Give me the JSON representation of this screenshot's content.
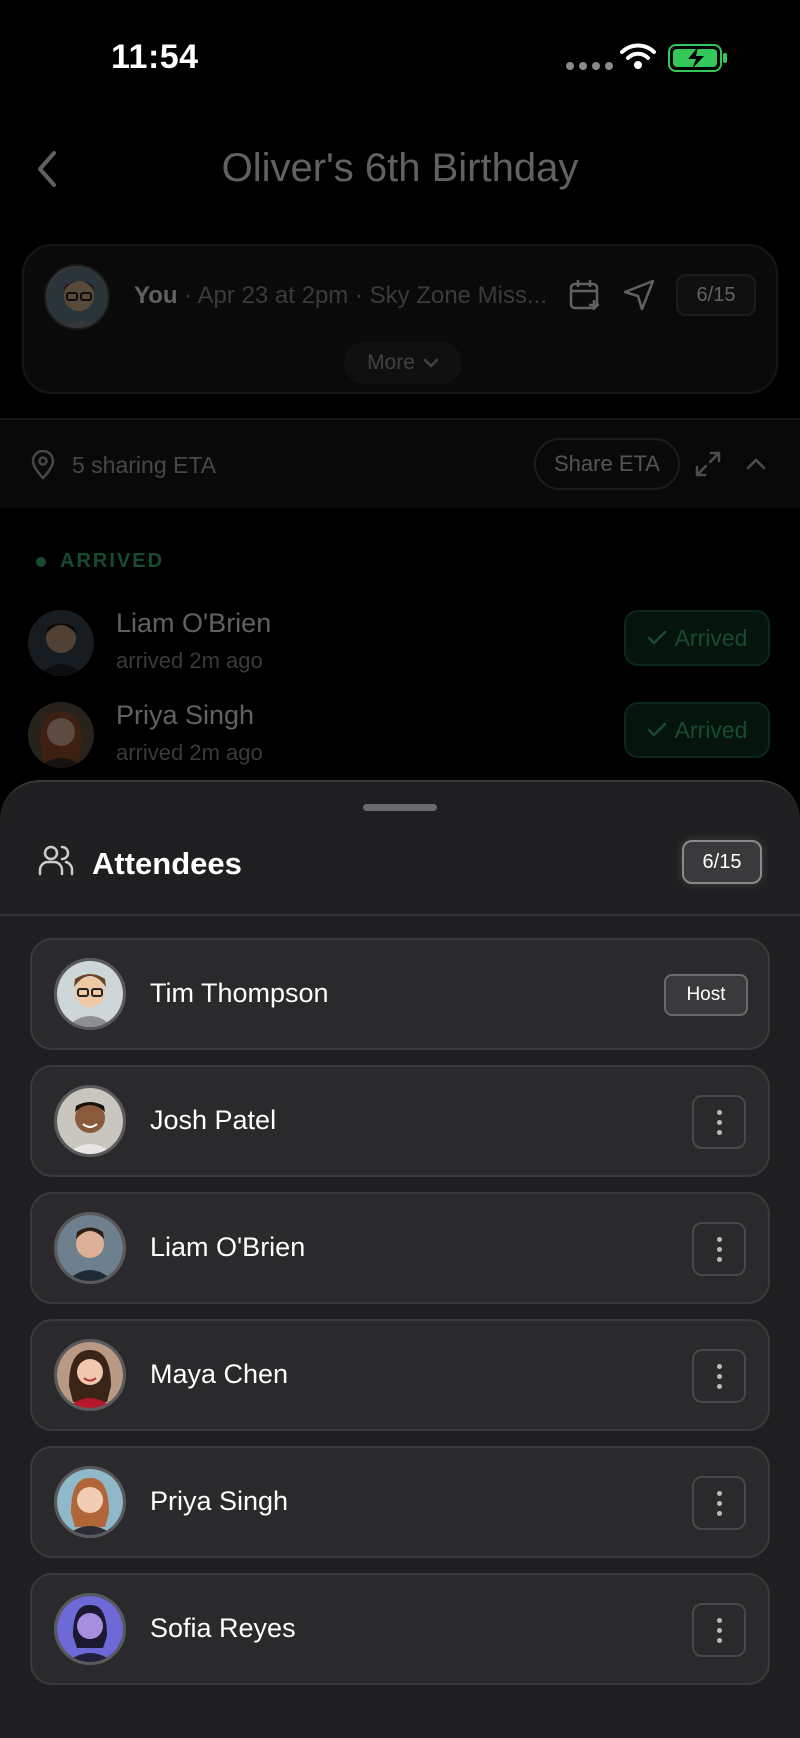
{
  "status_bar": {
    "time": "11:54"
  },
  "header": {
    "title": "Oliver's 6th Birthday"
  },
  "event_card": {
    "you_label": "You",
    "details": " · Apr 23 at 2pm · Sky Zone Miss...",
    "count": "6/15",
    "more_label": "More"
  },
  "eta": {
    "sharing_text": "5 sharing ETA",
    "share_button": "Share ETA"
  },
  "arrived_section": {
    "heading": "ARRIVED",
    "items": [
      {
        "name": "Liam O'Brien",
        "sub": "arrived 2m ago",
        "badge": "Arrived"
      },
      {
        "name": "Priya Singh",
        "sub": "arrived 2m ago",
        "badge": "Arrived"
      }
    ]
  },
  "sheet": {
    "title": "Attendees",
    "count": "6/15",
    "attendees": [
      {
        "name": "Tim Thompson",
        "badge": "Host"
      },
      {
        "name": "Josh Patel"
      },
      {
        "name": "Liam O'Brien"
      },
      {
        "name": "Maya Chen"
      },
      {
        "name": "Priya Singh"
      },
      {
        "name": "Sofia Reyes"
      }
    ]
  },
  "colors": {
    "accent_green": "#3ec47a",
    "battery_green": "#34c759",
    "sheet_bg": "#1f1f21",
    "card_bg": "#2a2a2c"
  },
  "icons": [
    "back-icon",
    "calendar-plus-icon",
    "navigation-icon",
    "map-pin-icon",
    "expand-icon",
    "chevron-up-icon",
    "chevron-down-icon",
    "people-icon",
    "more-vertical-icon",
    "check-icon",
    "wifi-icon",
    "battery-charging-icon"
  ]
}
